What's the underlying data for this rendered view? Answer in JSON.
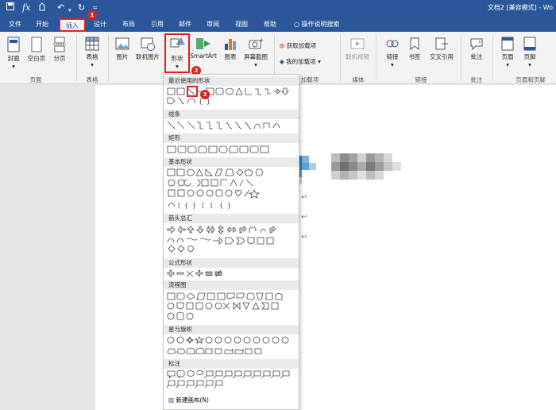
{
  "window": {
    "title": "文档2 [兼容模式] - Wo"
  },
  "ribbon_tabs": [
    {
      "label": "文件"
    },
    {
      "label": "开始"
    },
    {
      "label": "插入"
    },
    {
      "label": "设计"
    },
    {
      "label": "布局"
    },
    {
      "label": "引用"
    },
    {
      "label": "邮件"
    },
    {
      "label": "审阅"
    },
    {
      "label": "视图"
    },
    {
      "label": "帮助"
    }
  ],
  "tell_me": "操作说明搜索",
  "ribbon": {
    "cover": "封面",
    "blank_page": "空白页",
    "page_break": "分页",
    "table": "表格",
    "picture": "图片",
    "online_picture": "联机图片",
    "shapes": "形状",
    "smartart": "SmartArt",
    "chart": "图表",
    "screenshot": "屏幕截图",
    "get_addins": "获取加载项",
    "my_addins": "我的加载项",
    "online_video": "联机视频",
    "link": "链接",
    "bookmark": "书签",
    "crossref": "交叉引用",
    "comment": "批注",
    "header": "页眉",
    "footer": "页脚",
    "groups": {
      "pages": "页面",
      "tables": "表格",
      "addins": "加载项",
      "media": "媒体",
      "links": "链接",
      "comments": "批注",
      "headerfooter": "页眉和页脚"
    }
  },
  "steps": {
    "step1": "1",
    "step2": "2",
    "step3": "3"
  },
  "dropdown": {
    "sections": [
      {
        "label": "最近使用的形状"
      },
      {
        "label": "线条"
      },
      {
        "label": "矩形"
      },
      {
        "label": "基本形状"
      },
      {
        "label": "箭头总汇"
      },
      {
        "label": "公式形状"
      },
      {
        "label": "流程图"
      },
      {
        "label": "星与旗帜"
      },
      {
        "label": "标注"
      }
    ],
    "new_canvas": "新建画布(N)"
  },
  "colors": {
    "accent": "#2b579a",
    "highlight": "#d8241c"
  }
}
